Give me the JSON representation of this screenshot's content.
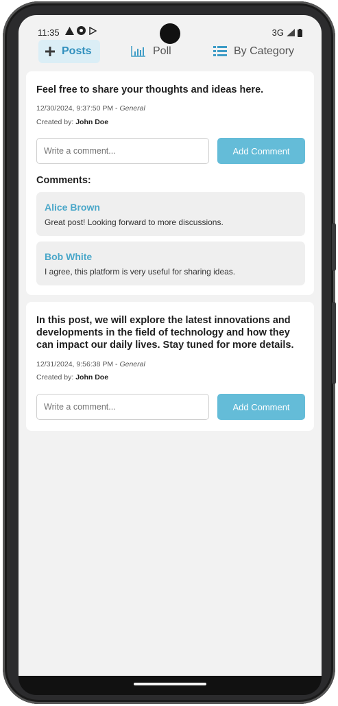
{
  "status_bar": {
    "time": "11:35",
    "network": "3G"
  },
  "tabs": [
    {
      "label": "Posts",
      "icon": "plus-icon",
      "active": true
    },
    {
      "label": "Poll",
      "icon": "bar-chart-icon",
      "active": false
    },
    {
      "label": "By Category",
      "icon": "list-icon",
      "active": false
    }
  ],
  "posts": [
    {
      "text": "Feel free to share your thoughts and ideas here.",
      "datetime": "12/30/2024, 9:37:50 PM",
      "category": "General",
      "created_by_label": "Created by:",
      "author": "John Doe",
      "comment_placeholder": "Write a comment...",
      "add_comment_label": "Add Comment",
      "comments_heading": "Comments:",
      "comments": [
        {
          "author": "Alice Brown",
          "text": "Great post! Looking forward to more discussions."
        },
        {
          "author": "Bob White",
          "text": "I agree, this platform is very useful for sharing ideas."
        }
      ]
    },
    {
      "text": "In this post, we will explore the latest innovations and developments in the field of technology and how they can impact our daily lives. Stay tuned for more details.",
      "datetime": "12/31/2024, 9:56:38 PM",
      "category": "General",
      "created_by_label": "Created by:",
      "author": "John Doe",
      "comment_placeholder": "Write a comment...",
      "add_comment_label": "Add Comment"
    }
  ],
  "colors": {
    "accent": "#64bcd8",
    "author_link": "#4aa7c9",
    "active_tab_bg": "#dbeef6",
    "screen_bg": "#f2f2f2"
  }
}
